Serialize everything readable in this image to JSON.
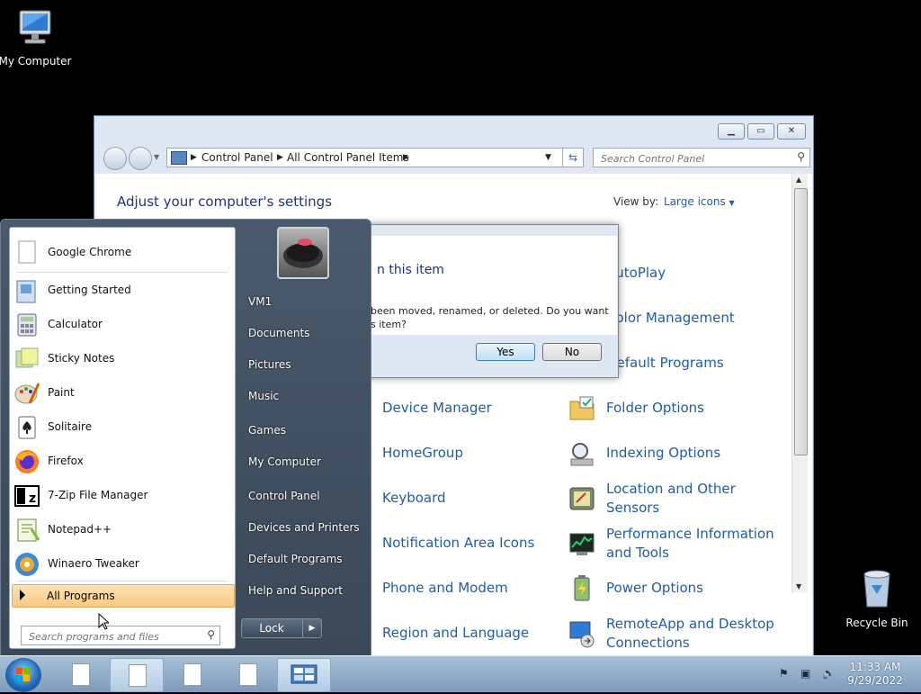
{
  "desktop": {
    "icons": [
      {
        "label": "My Computer"
      },
      {
        "label": "Recycle Bin"
      }
    ]
  },
  "control_panel": {
    "address": {
      "crumbs": [
        "Control Panel",
        "All Control Panel Items"
      ]
    },
    "search_placeholder": "Search Control Panel",
    "heading": "Adjust your computer's settings",
    "view_by_label": "View by:",
    "view_by_value": "Large icons",
    "items": [
      {
        "label": "AutoPlay",
        "icon": "autoplay-icon"
      },
      {
        "label": "Color Management",
        "icon": "color-management-icon"
      },
      {
        "label": "Default Programs",
        "icon": "default-programs-icon"
      },
      {
        "label": "Device Manager",
        "icon": "device-manager-icon"
      },
      {
        "label": "Folder Options",
        "icon": "folder-options-icon"
      },
      {
        "label": "HomeGroup",
        "icon": "homegroup-icon"
      },
      {
        "label": "Indexing Options",
        "icon": "indexing-options-icon"
      },
      {
        "label": "Keyboard",
        "icon": "keyboard-icon"
      },
      {
        "label": "Location and Other Sensors",
        "icon": "location-sensors-icon"
      },
      {
        "label": "Notification Area Icons",
        "icon": "notification-area-icon"
      },
      {
        "label": "Performance Information and Tools",
        "icon": "performance-icon"
      },
      {
        "label": "Phone and Modem",
        "icon": "phone-modem-icon"
      },
      {
        "label": "Power Options",
        "icon": "power-options-icon"
      },
      {
        "label": "Region and Language",
        "icon": "region-language-icon"
      },
      {
        "label": "RemoteApp and Desktop Connections",
        "icon": "remoteapp-icon"
      }
    ]
  },
  "dialog": {
    "title_partial": "n this item",
    "message_partial": "been moved, renamed, or deleted. Do you want\ns item?",
    "yes_label": "Yes",
    "no_label": "No"
  },
  "start_menu": {
    "programs": [
      {
        "label": "Google Chrome"
      },
      {
        "label": "Getting Started"
      },
      {
        "label": "Calculator"
      },
      {
        "label": "Sticky Notes"
      },
      {
        "label": "Paint"
      },
      {
        "label": "Solitaire"
      },
      {
        "label": "Firefox"
      },
      {
        "label": "7-Zip File Manager"
      },
      {
        "label": "Notepad++"
      },
      {
        "label": "Winaero Tweaker"
      }
    ],
    "all_programs_label": "All Programs",
    "search_placeholder": "Search programs and files",
    "right_items": [
      {
        "label": "VM1"
      },
      {
        "label": "Documents"
      },
      {
        "label": "Pictures"
      },
      {
        "label": "Music"
      },
      {
        "label": "Games"
      },
      {
        "label": "My Computer"
      },
      {
        "label": "Control Panel"
      },
      {
        "label": "Devices and Printers"
      },
      {
        "label": "Default Programs"
      },
      {
        "label": "Help and Support"
      }
    ],
    "lock_label": "Lock"
  },
  "taskbar": {
    "time": "11:33 AM",
    "date": "9/29/2022"
  }
}
